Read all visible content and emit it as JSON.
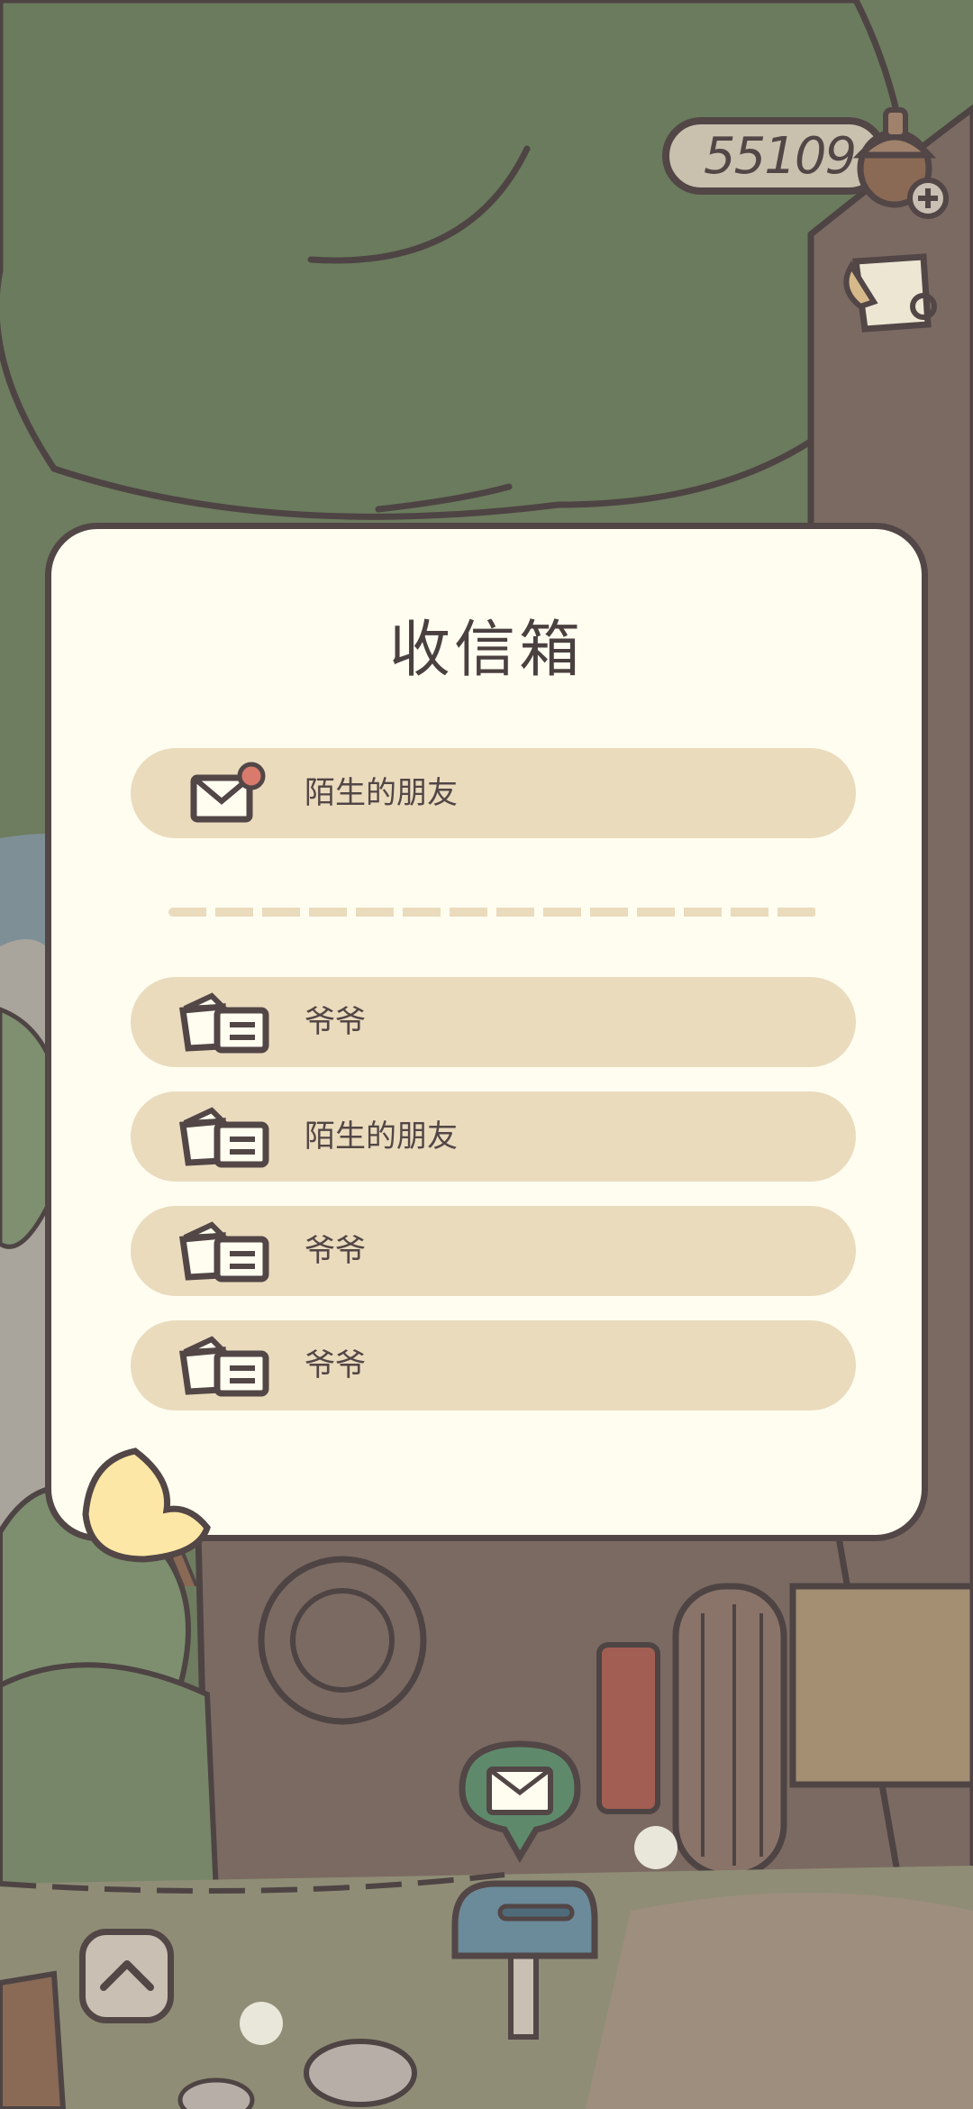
{
  "acorns": {
    "count": "55109"
  },
  "inbox": {
    "title": "收信箱",
    "new_letters": [
      {
        "sender": "陌生的朋友",
        "icon": "envelope-unread-icon"
      }
    ],
    "read_letters": [
      {
        "sender": "爷爷",
        "icon": "open-letter-icon"
      },
      {
        "sender": "陌生的朋友",
        "icon": "open-letter-icon"
      },
      {
        "sender": "爷爷",
        "icon": "open-letter-icon"
      },
      {
        "sender": "爷爷",
        "icon": "open-letter-icon"
      }
    ]
  },
  "colors": {
    "outline": "#524646",
    "panel_bg": "#fffdf0",
    "row_bg": "#eadbbd",
    "foliage": "#6e7c5f",
    "notification_dot": "#d97a6c"
  }
}
